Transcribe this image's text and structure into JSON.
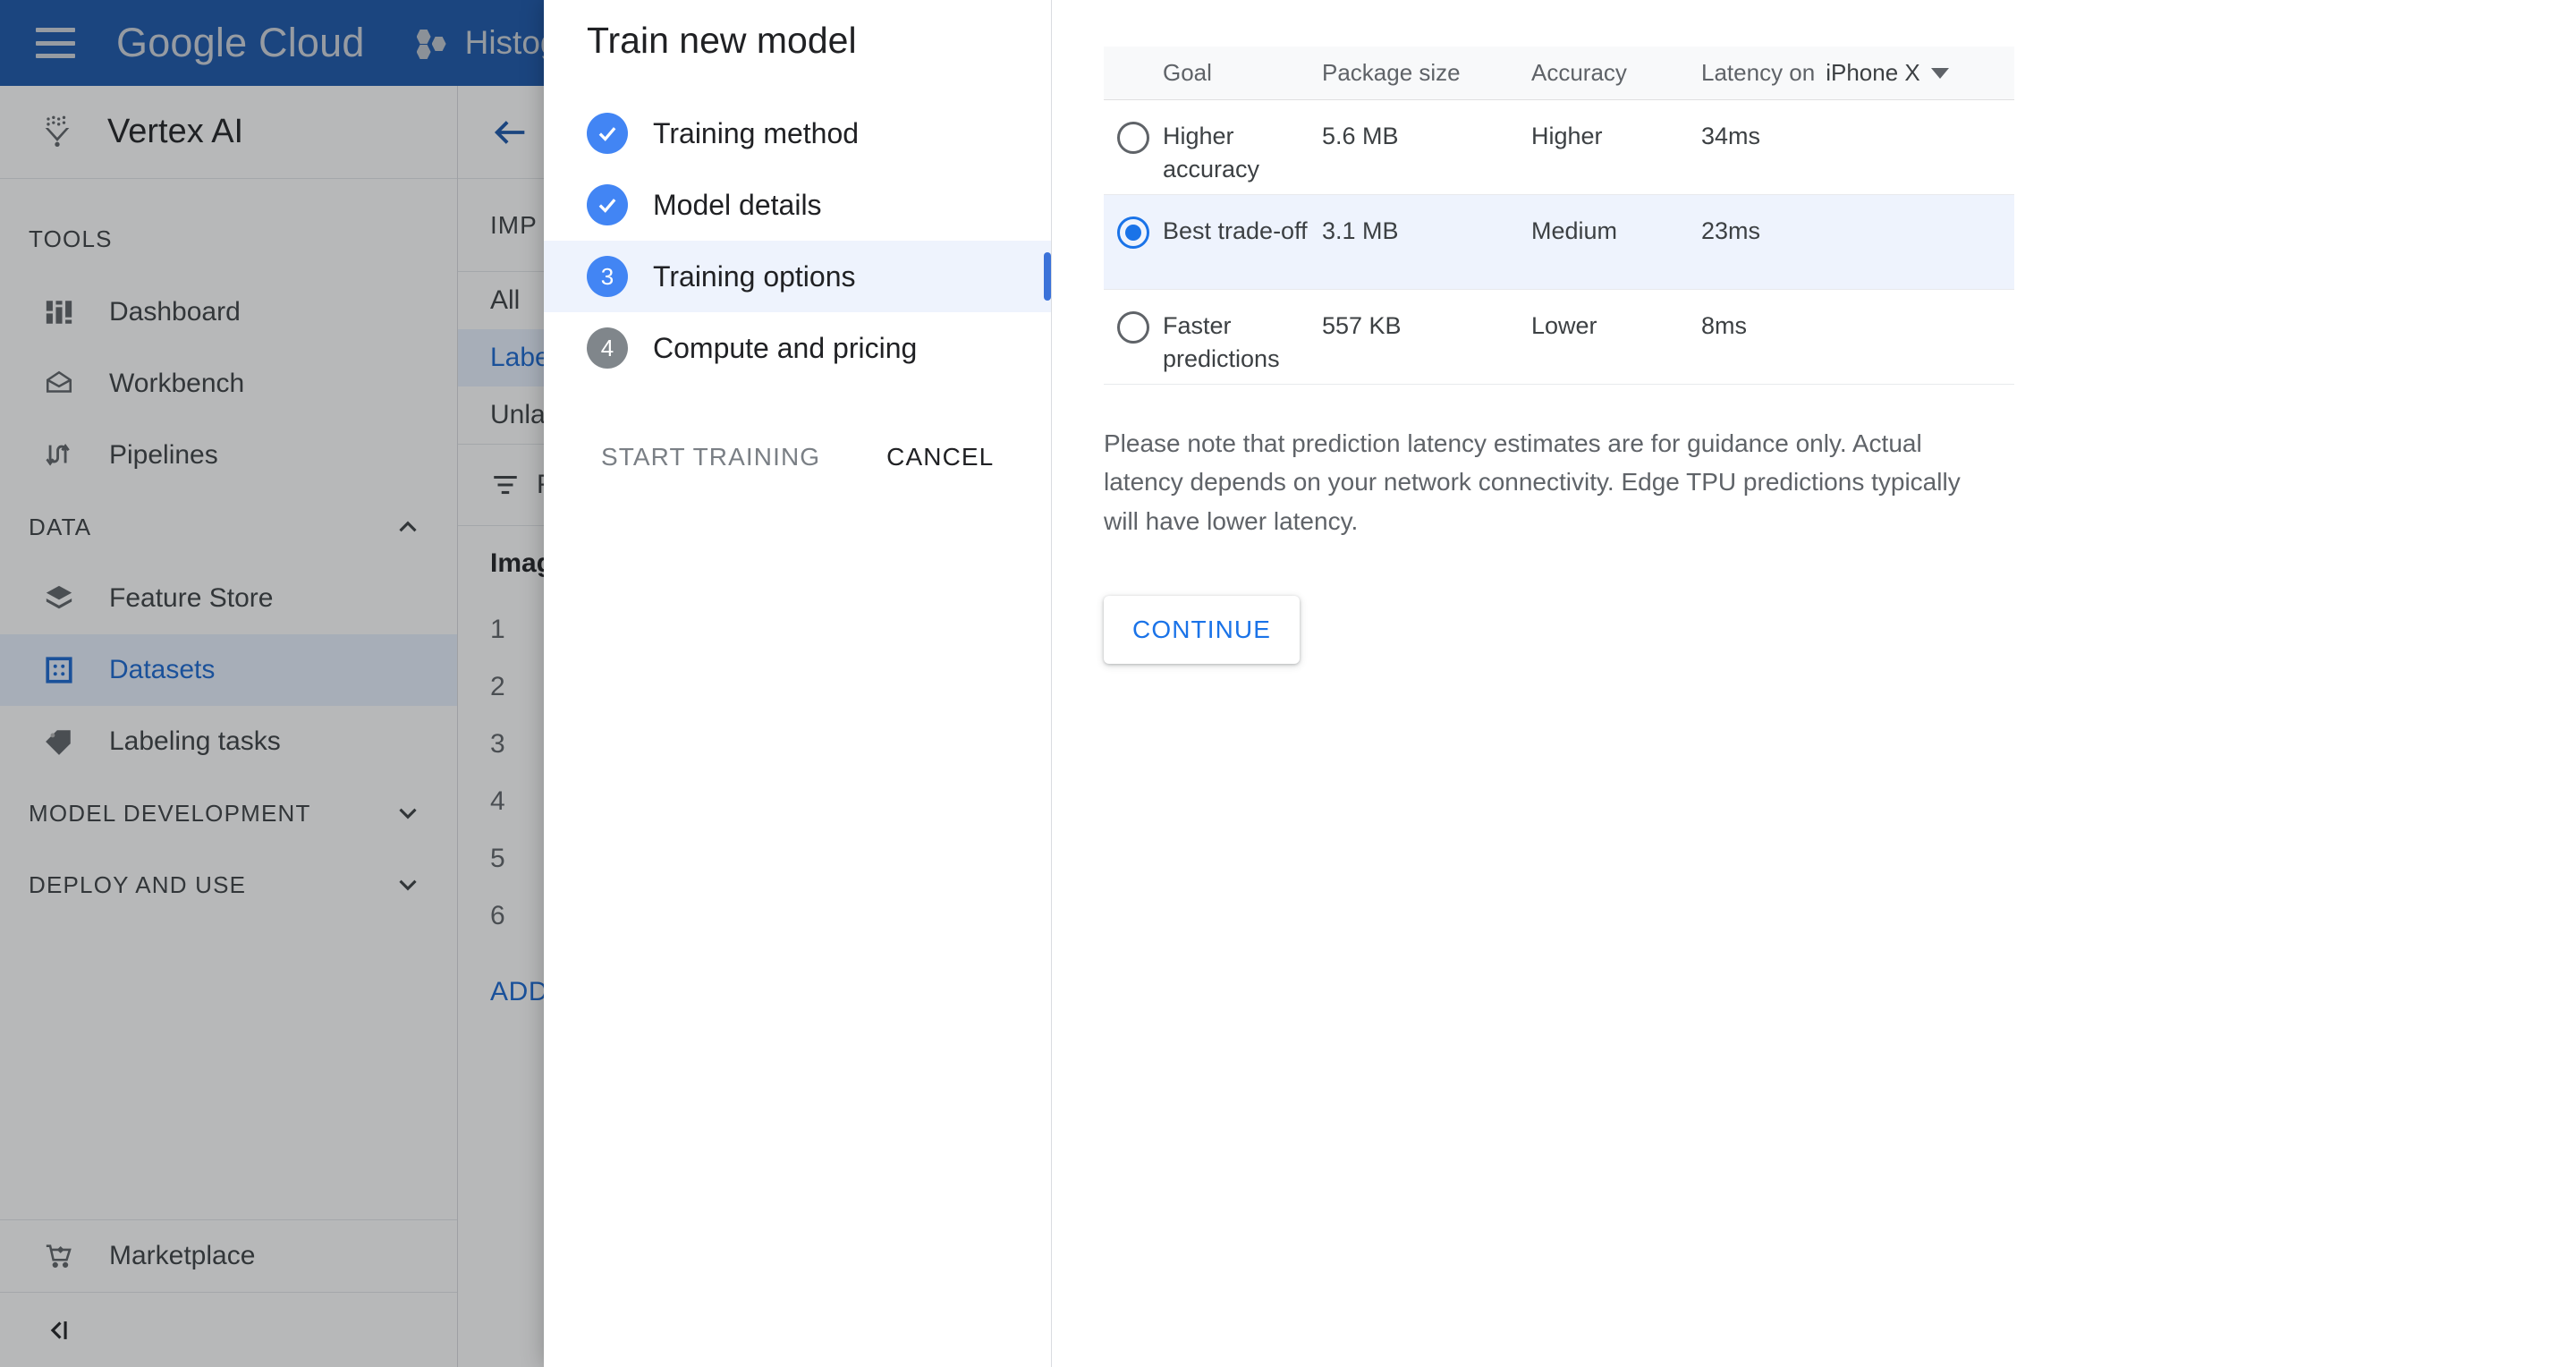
{
  "topbar": {
    "brand": "Google Cloud",
    "project": "Histogramo",
    "menu_icon": "hamburger-icon"
  },
  "sidebar": {
    "product_title": "Vertex AI",
    "sections": [
      {
        "label": "TOOLS",
        "collapsible": false
      },
      {
        "label": "DATA",
        "collapsible": true
      },
      {
        "label": "MODEL DEVELOPMENT",
        "collapsible": true
      },
      {
        "label": "DEPLOY AND USE",
        "collapsible": true
      }
    ],
    "tools_items": [
      {
        "label": "Dashboard",
        "icon": "dashboard-icon"
      },
      {
        "label": "Workbench",
        "icon": "workbench-icon"
      },
      {
        "label": "Pipelines",
        "icon": "pipelines-icon"
      }
    ],
    "data_items": [
      {
        "label": "Feature Store",
        "icon": "layers-icon",
        "active": false
      },
      {
        "label": "Datasets",
        "icon": "datasets-icon",
        "active": true
      },
      {
        "label": "Labeling tasks",
        "icon": "tag-icon",
        "active": false
      }
    ],
    "bottom": {
      "label": "Marketplace",
      "icon": "cart-icon"
    },
    "collapse_label": "‹|"
  },
  "background_page": {
    "back_icon": "arrow-left-icon",
    "import_tab": "IMP",
    "segments": [
      {
        "label": "All",
        "active": false
      },
      {
        "label": "Label",
        "active": true
      },
      {
        "label": "Unlab",
        "active": false
      }
    ],
    "filter_label": "F",
    "list_header": "Image",
    "rows": [
      "1",
      "2",
      "3",
      "4",
      "5",
      "6"
    ],
    "add_link": "ADD"
  },
  "dialog": {
    "title": "Train new model",
    "steps": [
      {
        "badge": "✓",
        "state": "done",
        "label": "Training method"
      },
      {
        "badge": "✓",
        "state": "done",
        "label": "Model details"
      },
      {
        "badge": "3",
        "state": "current",
        "label": "Training options"
      },
      {
        "badge": "4",
        "state": "todo",
        "label": "Compute and pricing"
      }
    ],
    "actions": {
      "start_training": "START TRAINING",
      "start_training_disabled": true,
      "cancel": "CANCEL"
    },
    "table": {
      "headers": {
        "radio": "",
        "goal": "Goal",
        "package_size": "Package size",
        "accuracy": "Accuracy",
        "latency_prefix": "Latency on",
        "latency_device": "iPhone X",
        "latency_caret": "chevron-down-icon"
      },
      "rows": [
        {
          "selected": false,
          "goal": "Higher accuracy",
          "package_size": "5.6 MB",
          "accuracy": "Higher",
          "latency": "34ms"
        },
        {
          "selected": true,
          "goal": "Best trade-off",
          "package_size": "3.1 MB",
          "accuracy": "Medium",
          "latency": "23ms"
        },
        {
          "selected": false,
          "goal": "Faster predictions",
          "package_size": "557 KB",
          "accuracy": "Lower",
          "latency": "8ms"
        }
      ]
    },
    "note": "Please note that prediction latency estimates are for guidance only. Actual latency depends on your network connectivity. Edge TPU predictions typically will have lower latency.",
    "continue_label": "CONTINUE"
  },
  "colors": {
    "topbar_blue": "#1a56aa",
    "accent_blue": "#1a73e8",
    "step_blue": "#4285f4",
    "selected_row": "#eef3fd",
    "nav_active": "#e8f0fe"
  }
}
